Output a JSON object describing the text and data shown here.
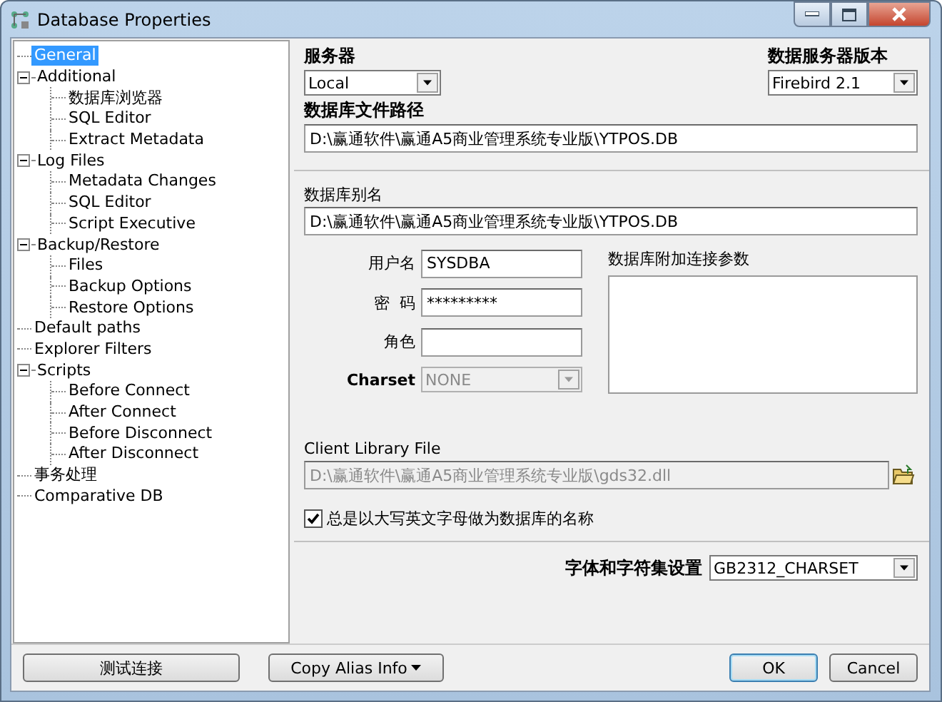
{
  "window": {
    "title": "Database Properties"
  },
  "tree": [
    {
      "label": "General",
      "selected": true,
      "expanded": false
    },
    {
      "label": "Additional",
      "selected": false,
      "expanded": true,
      "children": [
        {
          "label": "数据库浏览器",
          "selected": false
        },
        {
          "label": "SQL Editor",
          "selected": false
        },
        {
          "label": "Extract Metadata",
          "selected": false
        }
      ]
    },
    {
      "label": "Log Files",
      "selected": false,
      "expanded": true,
      "children": [
        {
          "label": "Metadata Changes",
          "selected": false
        },
        {
          "label": "SQL Editor",
          "selected": false
        },
        {
          "label": "Script Executive",
          "selected": false
        }
      ]
    },
    {
      "label": "Backup/Restore",
      "selected": false,
      "expanded": true,
      "children": [
        {
          "label": "Files",
          "selected": false
        },
        {
          "label": "Backup Options",
          "selected": false
        },
        {
          "label": "Restore Options",
          "selected": false
        }
      ]
    },
    {
      "label": "Default paths",
      "selected": false,
      "expanded": false
    },
    {
      "label": "Explorer Filters",
      "selected": false,
      "expanded": false
    },
    {
      "label": "Scripts",
      "selected": false,
      "expanded": true,
      "children": [
        {
          "label": "Before Connect",
          "selected": false
        },
        {
          "label": "After Connect",
          "selected": false
        },
        {
          "label": "Before Disconnect",
          "selected": false
        },
        {
          "label": "After Disconnect",
          "selected": false
        }
      ]
    },
    {
      "label": "事务处理",
      "selected": false,
      "expanded": false
    },
    {
      "label": "Comparative DB",
      "selected": false,
      "expanded": false
    }
  ],
  "server": {
    "label": "服务器",
    "value": "Local"
  },
  "server_version": {
    "label": "数据服务器版本",
    "value": "Firebird 2.1"
  },
  "db_file_path": {
    "label": "数据库文件路径",
    "value": "D:\\赢通软件\\赢通A5商业管理系统专业版\\YTPOS.DB"
  },
  "db_alias": {
    "label": "数据库别名",
    "value": "D:\\赢通软件\\赢通A5商业管理系统专业版\\YTPOS.DB"
  },
  "login": [
    {
      "kind": "text",
      "label": "用户名",
      "value": "SYSDBA",
      "disabled": false
    },
    {
      "kind": "text",
      "label": "密  码",
      "value": "*********",
      "disabled": false
    },
    {
      "kind": "text",
      "label": "角色",
      "disabled": false
    },
    {
      "kind": "select",
      "label": "Charset",
      "value": "NONE",
      "disabled": true
    }
  ],
  "extra_params": {
    "label": "数据库附加连接参数"
  },
  "client_library": {
    "label": "Client Library File",
    "value": "D:\\赢通软件\\赢通A5商业管理系统专业版\\gds32.dll",
    "disabled": true
  },
  "uppercase_names": {
    "label": "总是以大写英文字母做为数据库的名称",
    "checked": true
  },
  "font_charset": {
    "label": "字体和字符集设置",
    "value": "GB2312_CHARSET"
  },
  "buttons": [
    {
      "label": "测试连接",
      "kind": "plain"
    },
    {
      "label": "Copy Alias Info",
      "kind": "menu"
    },
    {
      "label": "OK",
      "kind": "default"
    },
    {
      "label": "Cancel",
      "kind": "plain"
    }
  ]
}
